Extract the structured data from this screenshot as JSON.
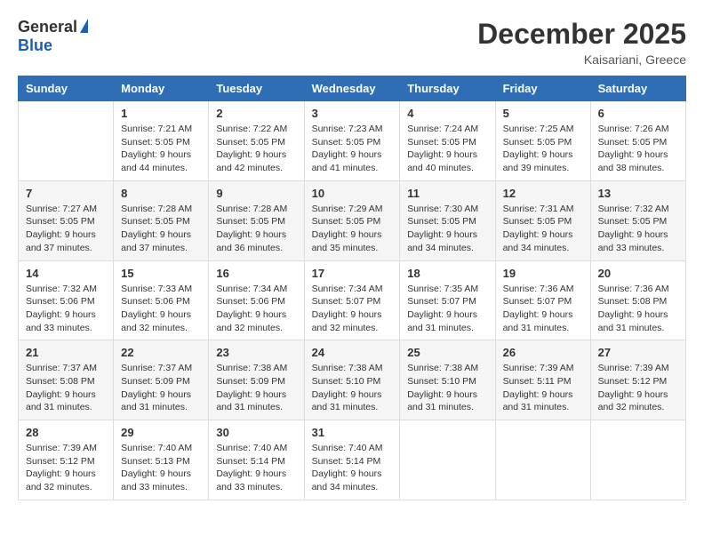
{
  "header": {
    "logo_general": "General",
    "logo_blue": "Blue",
    "month_title": "December 2025",
    "location": "Kaisariani, Greece"
  },
  "days_of_week": [
    "Sunday",
    "Monday",
    "Tuesday",
    "Wednesday",
    "Thursday",
    "Friday",
    "Saturday"
  ],
  "weeks": [
    [
      {
        "day": "",
        "sunrise": "",
        "sunset": "",
        "daylight": ""
      },
      {
        "day": "1",
        "sunrise": "Sunrise: 7:21 AM",
        "sunset": "Sunset: 5:05 PM",
        "daylight": "Daylight: 9 hours and 44 minutes."
      },
      {
        "day": "2",
        "sunrise": "Sunrise: 7:22 AM",
        "sunset": "Sunset: 5:05 PM",
        "daylight": "Daylight: 9 hours and 42 minutes."
      },
      {
        "day": "3",
        "sunrise": "Sunrise: 7:23 AM",
        "sunset": "Sunset: 5:05 PM",
        "daylight": "Daylight: 9 hours and 41 minutes."
      },
      {
        "day": "4",
        "sunrise": "Sunrise: 7:24 AM",
        "sunset": "Sunset: 5:05 PM",
        "daylight": "Daylight: 9 hours and 40 minutes."
      },
      {
        "day": "5",
        "sunrise": "Sunrise: 7:25 AM",
        "sunset": "Sunset: 5:05 PM",
        "daylight": "Daylight: 9 hours and 39 minutes."
      },
      {
        "day": "6",
        "sunrise": "Sunrise: 7:26 AM",
        "sunset": "Sunset: 5:05 PM",
        "daylight": "Daylight: 9 hours and 38 minutes."
      }
    ],
    [
      {
        "day": "7",
        "sunrise": "Sunrise: 7:27 AM",
        "sunset": "Sunset: 5:05 PM",
        "daylight": "Daylight: 9 hours and 37 minutes."
      },
      {
        "day": "8",
        "sunrise": "Sunrise: 7:28 AM",
        "sunset": "Sunset: 5:05 PM",
        "daylight": "Daylight: 9 hours and 37 minutes."
      },
      {
        "day": "9",
        "sunrise": "Sunrise: 7:28 AM",
        "sunset": "Sunset: 5:05 PM",
        "daylight": "Daylight: 9 hours and 36 minutes."
      },
      {
        "day": "10",
        "sunrise": "Sunrise: 7:29 AM",
        "sunset": "Sunset: 5:05 PM",
        "daylight": "Daylight: 9 hours and 35 minutes."
      },
      {
        "day": "11",
        "sunrise": "Sunrise: 7:30 AM",
        "sunset": "Sunset: 5:05 PM",
        "daylight": "Daylight: 9 hours and 34 minutes."
      },
      {
        "day": "12",
        "sunrise": "Sunrise: 7:31 AM",
        "sunset": "Sunset: 5:05 PM",
        "daylight": "Daylight: 9 hours and 34 minutes."
      },
      {
        "day": "13",
        "sunrise": "Sunrise: 7:32 AM",
        "sunset": "Sunset: 5:05 PM",
        "daylight": "Daylight: 9 hours and 33 minutes."
      }
    ],
    [
      {
        "day": "14",
        "sunrise": "Sunrise: 7:32 AM",
        "sunset": "Sunset: 5:06 PM",
        "daylight": "Daylight: 9 hours and 33 minutes."
      },
      {
        "day": "15",
        "sunrise": "Sunrise: 7:33 AM",
        "sunset": "Sunset: 5:06 PM",
        "daylight": "Daylight: 9 hours and 32 minutes."
      },
      {
        "day": "16",
        "sunrise": "Sunrise: 7:34 AM",
        "sunset": "Sunset: 5:06 PM",
        "daylight": "Daylight: 9 hours and 32 minutes."
      },
      {
        "day": "17",
        "sunrise": "Sunrise: 7:34 AM",
        "sunset": "Sunset: 5:07 PM",
        "daylight": "Daylight: 9 hours and 32 minutes."
      },
      {
        "day": "18",
        "sunrise": "Sunrise: 7:35 AM",
        "sunset": "Sunset: 5:07 PM",
        "daylight": "Daylight: 9 hours and 31 minutes."
      },
      {
        "day": "19",
        "sunrise": "Sunrise: 7:36 AM",
        "sunset": "Sunset: 5:07 PM",
        "daylight": "Daylight: 9 hours and 31 minutes."
      },
      {
        "day": "20",
        "sunrise": "Sunrise: 7:36 AM",
        "sunset": "Sunset: 5:08 PM",
        "daylight": "Daylight: 9 hours and 31 minutes."
      }
    ],
    [
      {
        "day": "21",
        "sunrise": "Sunrise: 7:37 AM",
        "sunset": "Sunset: 5:08 PM",
        "daylight": "Daylight: 9 hours and 31 minutes."
      },
      {
        "day": "22",
        "sunrise": "Sunrise: 7:37 AM",
        "sunset": "Sunset: 5:09 PM",
        "daylight": "Daylight: 9 hours and 31 minutes."
      },
      {
        "day": "23",
        "sunrise": "Sunrise: 7:38 AM",
        "sunset": "Sunset: 5:09 PM",
        "daylight": "Daylight: 9 hours and 31 minutes."
      },
      {
        "day": "24",
        "sunrise": "Sunrise: 7:38 AM",
        "sunset": "Sunset: 5:10 PM",
        "daylight": "Daylight: 9 hours and 31 minutes."
      },
      {
        "day": "25",
        "sunrise": "Sunrise: 7:38 AM",
        "sunset": "Sunset: 5:10 PM",
        "daylight": "Daylight: 9 hours and 31 minutes."
      },
      {
        "day": "26",
        "sunrise": "Sunrise: 7:39 AM",
        "sunset": "Sunset: 5:11 PM",
        "daylight": "Daylight: 9 hours and 31 minutes."
      },
      {
        "day": "27",
        "sunrise": "Sunrise: 7:39 AM",
        "sunset": "Sunset: 5:12 PM",
        "daylight": "Daylight: 9 hours and 32 minutes."
      }
    ],
    [
      {
        "day": "28",
        "sunrise": "Sunrise: 7:39 AM",
        "sunset": "Sunset: 5:12 PM",
        "daylight": "Daylight: 9 hours and 32 minutes."
      },
      {
        "day": "29",
        "sunrise": "Sunrise: 7:40 AM",
        "sunset": "Sunset: 5:13 PM",
        "daylight": "Daylight: 9 hours and 33 minutes."
      },
      {
        "day": "30",
        "sunrise": "Sunrise: 7:40 AM",
        "sunset": "Sunset: 5:14 PM",
        "daylight": "Daylight: 9 hours and 33 minutes."
      },
      {
        "day": "31",
        "sunrise": "Sunrise: 7:40 AM",
        "sunset": "Sunset: 5:14 PM",
        "daylight": "Daylight: 9 hours and 34 minutes."
      },
      {
        "day": "",
        "sunrise": "",
        "sunset": "",
        "daylight": ""
      },
      {
        "day": "",
        "sunrise": "",
        "sunset": "",
        "daylight": ""
      },
      {
        "day": "",
        "sunrise": "",
        "sunset": "",
        "daylight": ""
      }
    ]
  ]
}
